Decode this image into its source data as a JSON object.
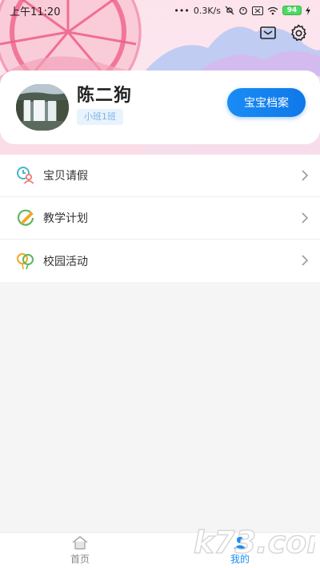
{
  "status_bar": {
    "time": "上午11:20",
    "network_speed": "0.3K/s",
    "battery": "94"
  },
  "header": {
    "actions": [
      {
        "icon": "mail-icon"
      },
      {
        "icon": "gear-icon"
      }
    ]
  },
  "profile": {
    "name": "陈二狗",
    "class_label": "小班1班",
    "archive_button": "宝宝档案"
  },
  "menu": {
    "items": [
      {
        "label": "宝贝请假",
        "icon": "leave-request-icon"
      },
      {
        "label": "教学计划",
        "icon": "teaching-plan-icon"
      },
      {
        "label": "校园活动",
        "icon": "campus-activity-icon"
      }
    ]
  },
  "bottom_nav": {
    "items": [
      {
        "label": "首页",
        "icon": "home-icon",
        "active": false
      },
      {
        "label": "我的",
        "icon": "profile-icon",
        "active": true
      }
    ]
  },
  "watermark": {
    "text": "k73.com"
  },
  "colors": {
    "accent": "#1a8cf5",
    "badge_bg": "#e8f3fd",
    "badge_text": "#7db2e6"
  }
}
